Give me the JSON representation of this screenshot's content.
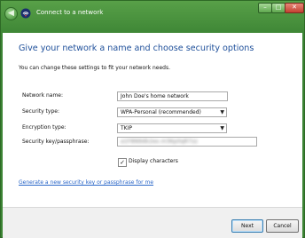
{
  "window": {
    "title": "Connect to a network",
    "icons": {
      "back": "back-arrow-icon",
      "network": "wireless-network-icon"
    },
    "controls": {
      "minimize": "minimize-icon",
      "maximize": "maximize-icon",
      "close": "close-icon"
    }
  },
  "page": {
    "heading": "Give your network a name and choose security options",
    "subtext": "You can change these settings to fit your network needs."
  },
  "form": {
    "network_name": {
      "label": "Network name:",
      "value": "John Doe's home network"
    },
    "security_type": {
      "label": "Security type:",
      "value": "WPA-Personal (recommended)"
    },
    "encryption_type": {
      "label": "Encryption type:",
      "value": "TKIP"
    },
    "security_key": {
      "label": "Security key/passphrase:",
      "value": "a1F8N9dk2ex.m3Kp0qR7zz"
    },
    "display_characters": {
      "label": "Display characters",
      "checked": true
    }
  },
  "link": {
    "text": "Generate a new security key or passphrase for me"
  },
  "buttons": {
    "next": "Next",
    "cancel": "Cancel"
  },
  "colors": {
    "title_bar": "#4a9a3e",
    "heading": "#1e4f9a",
    "link": "#2a66c8"
  }
}
